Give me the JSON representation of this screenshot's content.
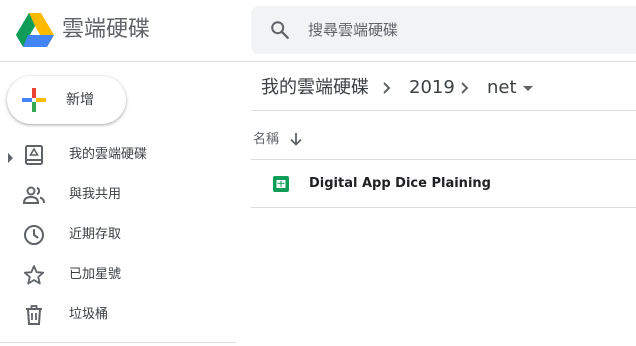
{
  "header": {
    "app_title": "雲端硬碟",
    "search_placeholder": "搜尋雲端硬碟",
    "logo_icon": "google-drive-logo",
    "search_icon": "search-icon"
  },
  "sidebar": {
    "new_button_label": "新增",
    "items": [
      {
        "label": "我的雲端硬碟",
        "icon": "my-drive-icon",
        "expandable": true
      },
      {
        "label": "與我共用",
        "icon": "people-icon"
      },
      {
        "label": "近期存取",
        "icon": "clock-icon"
      },
      {
        "label": "已加星號",
        "icon": "star-icon"
      },
      {
        "label": "垃圾桶",
        "icon": "trash-icon"
      }
    ]
  },
  "breadcrumb": {
    "items": [
      "我的雲端硬碟",
      "2019",
      "net"
    ]
  },
  "file_list": {
    "column_name": "名稱",
    "sort_direction": "descending",
    "files": [
      {
        "name": "Digital App Dice Plaining",
        "type": "google-sheets"
      }
    ]
  },
  "colors": {
    "sheets_green": "#0f9d58",
    "text_primary": "#202124",
    "text_secondary": "#5f6368",
    "search_bg": "#f1f3f4",
    "divider": "#dadce0"
  }
}
